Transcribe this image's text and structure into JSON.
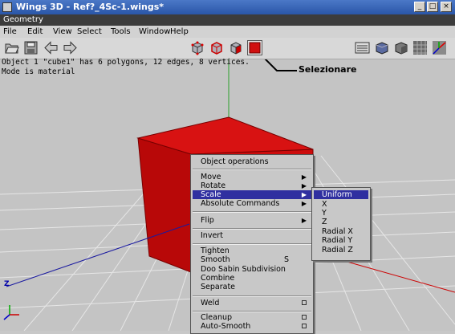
{
  "window": {
    "title": "Wings 3D - Ref?_4Sc-1.wings*",
    "buttons": [
      "_",
      "□",
      "×"
    ]
  },
  "geometry_bar": {
    "label": "Geometry"
  },
  "menubar": {
    "items": [
      "File",
      "Edit",
      "View",
      "Select",
      "Tools",
      "Window",
      "Help"
    ]
  },
  "toolbar": {
    "left_icons": [
      "open-folder-icon",
      "save-disk-icon",
      "undo-arrow-icon",
      "redo-arrow-icon"
    ],
    "selection_modes": [
      "vertex-mode-icon",
      "edge-mode-icon",
      "face-mode-icon",
      "body-mode-icon"
    ],
    "right_icons": [
      "workmode-icon",
      "smooth-shading-icon",
      "flat-shading-icon",
      "grid-toggle-icon",
      "axes-toggle-icon"
    ]
  },
  "info": {
    "line1": "Object 1 \"cube1\" has 6 polygons, 12 edges, 8 vertices.",
    "line2": "Mode is material"
  },
  "callout": {
    "label": "Selezionare"
  },
  "context_menu": {
    "title": "Object operations",
    "groups": [
      [
        {
          "label": "Move",
          "submenu": true
        },
        {
          "label": "Rotate",
          "submenu": true
        },
        {
          "label": "Scale",
          "submenu": true,
          "selected": true
        },
        {
          "label": "Absolute Commands",
          "submenu": true
        }
      ],
      [
        {
          "label": "Flip",
          "submenu": true
        }
      ],
      [
        {
          "label": "Invert"
        }
      ],
      [
        {
          "label": "Tighten"
        },
        {
          "label": "Smooth",
          "shortcut": "S"
        },
        {
          "label": "Doo Sabin Subdivision"
        },
        {
          "label": "Combine"
        },
        {
          "label": "Separate"
        }
      ],
      [
        {
          "label": "Weld",
          "option_box": true
        }
      ],
      [
        {
          "label": "Cleanup",
          "option_box": true
        },
        {
          "label": "Auto-Smooth",
          "option_box": true
        }
      ]
    ]
  },
  "scale_submenu": {
    "items": [
      "Uniform",
      "X",
      "Y",
      "Z",
      "Radial X",
      "Radial Y",
      "Radial Z"
    ],
    "selected": "Uniform"
  },
  "axes": {
    "z_label": "Z"
  },
  "colors": {
    "cube": "#c00a0a",
    "menu_highlight": "#2f2fa0",
    "titlebar": "#2a56a8"
  }
}
